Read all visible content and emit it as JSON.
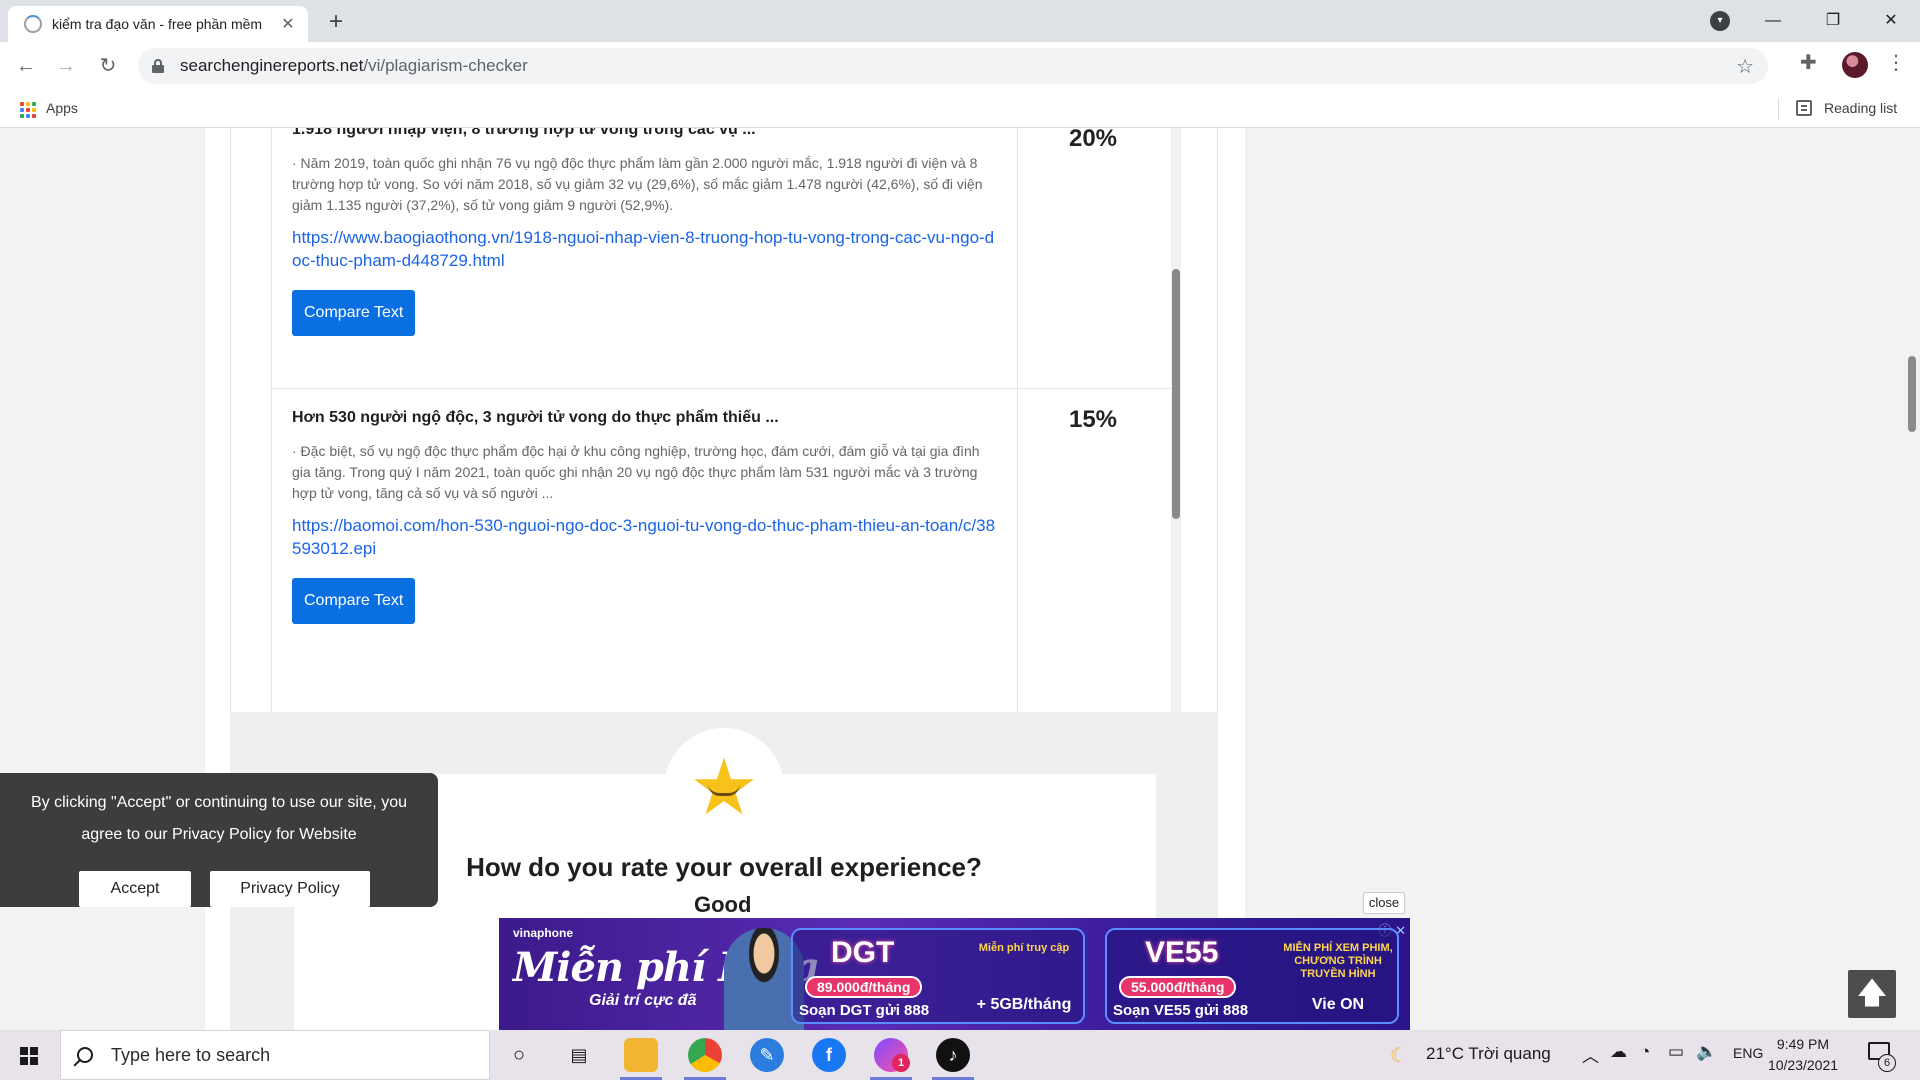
{
  "browser": {
    "tab_title": "kiểm tra đạo văn - free phần mềm",
    "tab_close": "✕",
    "new_tab": "+",
    "url_domain": "searchenginereports.net",
    "url_path": "/vi/plagiarism-checker",
    "bookmarks": {
      "apps_label": "Apps",
      "reading_list_label": "Reading list"
    },
    "window_controls": {
      "minimize": "—",
      "restore": "❐",
      "close": "✕"
    }
  },
  "results": [
    {
      "title": "1.918 người nhập viện, 8 trường hợp tử vong trong các vụ ...",
      "snippet": "· Năm 2019, toàn quốc ghi nhận 76 vụ ngộ độc thực phẩm làm gần 2.000 người mắc, 1.918 người đi viện và 8 trường hợp tử vong. So với năm 2018, số vụ giảm 32 vụ (29,6%), số mắc giảm 1.478 người (42,6%), số đi viện giảm 1.135 người (37,2%), số tử vong giảm 9 người (52,9%).",
      "url": "https://www.baogiaothong.vn/1918-nguoi-nhap-vien-8-truong-hop-tu-vong-trong-cac-vu-ngo-doc-thuc-pham-d448729.html",
      "button": "Compare Text",
      "score": "20%"
    },
    {
      "title": "Hơn 530 người ngộ độc, 3 người tử vong do thực phẩm thiếu ...",
      "snippet": "· Đặc biệt, số vụ ngộ độc thực phẩm độc hại ở khu công nghiệp, trường học, đám cưới, đám giỗ và tại gia đình gia tăng. Trong quý I năm 2021, toàn quốc ghi nhận 20 vụ ngộ độc thực phẩm làm 531 người mắc và 3 trường hợp tử vong, tăng cả số vụ và số người ...",
      "url": "https://baomoi.com/hon-530-nguoi-ngo-doc-3-nguoi-tu-vong-do-thuc-pham-thieu-an-toan/c/38593012.epi",
      "button": "Compare Text",
      "score": "15%"
    }
  ],
  "rating": {
    "question": "How do you rate your overall experience?",
    "partial_label": "Good"
  },
  "cookie": {
    "text": "By clicking \"Accept\" or continuing to use our site, you agree to our Privacy Policy for Website",
    "accept": "Accept",
    "policy": "Privacy Policy"
  },
  "ad": {
    "close_label": "close",
    "brand": "vinaphone",
    "headline": "Miễn phí Data",
    "sub": "Giải trí cực đã",
    "offers": [
      {
        "code": "DGT",
        "price": "89.000đ/tháng",
        "sms": "Soạn DGT gửi 888",
        "extra_title": "Miễn phí truy cập",
        "extra_value": "+ 5GB/tháng"
      },
      {
        "code": "VE55",
        "price": "55.000đ/tháng",
        "sms": "Soạn VE55 gửi 888",
        "extra_title": "MIỄN PHÍ XEM PHIM, CHƯƠNG TRÌNH TRUYỀN HÌNH",
        "extra_value": "Vie ON"
      }
    ]
  },
  "taskbar": {
    "search_placeholder": "Type here to search",
    "weather": "21°C  Trời quang",
    "language": "ENG",
    "time": "9:49 PM",
    "date": "10/23/2021",
    "notification_count": "6",
    "messenger_badge": "1"
  },
  "colors": {
    "accent_blue": "#0a6fe0",
    "link_blue": "#1a64e8",
    "cookie_bg": "#3d3d3d",
    "ad_bg": "#3b1a8a"
  }
}
